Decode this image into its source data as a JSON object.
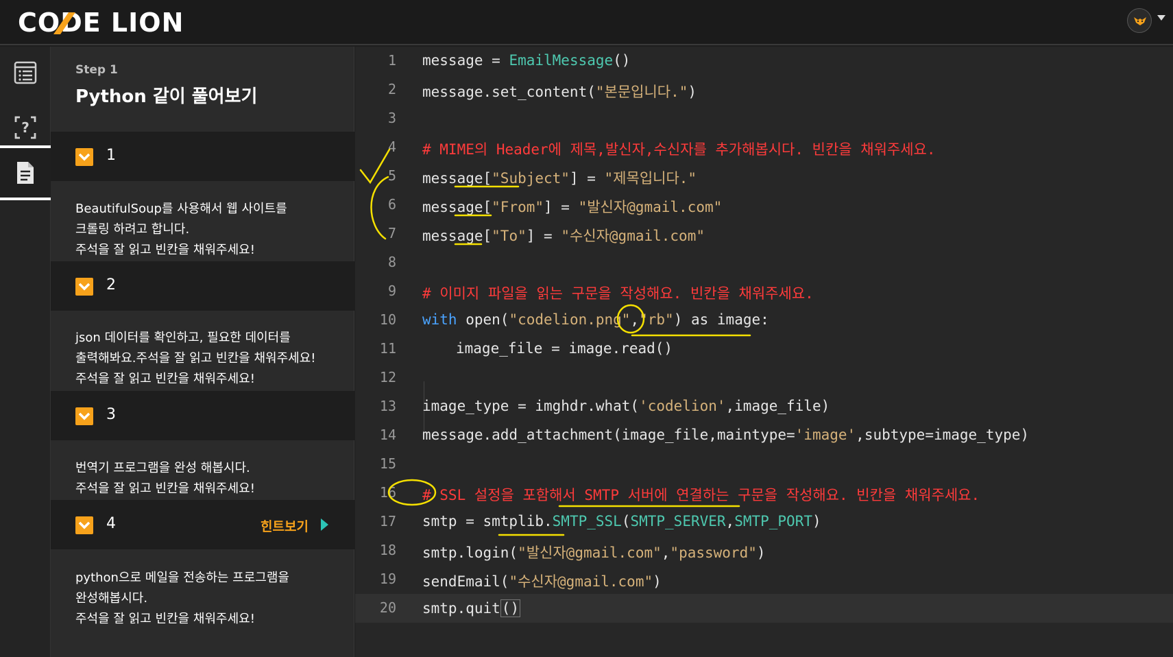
{
  "header": {
    "logo_text": "CODE LION"
  },
  "rail": {
    "items": [
      {
        "name": "list"
      },
      {
        "name": "quiz"
      },
      {
        "name": "document"
      }
    ]
  },
  "panel": {
    "step_label": "Step 1",
    "step_title": "Python 같이 풀어보기",
    "tasks": [
      {
        "num": "1",
        "desc": [
          "BeautifulSoup를 사용해서 웹 사이트를",
          "크롤링 하려고 합니다.",
          "주석을 잘 읽고 빈칸을 채워주세요!"
        ]
      },
      {
        "num": "2",
        "desc": [
          "json 데이터를 확인하고, 필요한 데이터를",
          "출력해봐요.주석을 잘 읽고 빈칸을 채워주세요!",
          "주석을 잘 읽고 빈칸을 채워주세요!"
        ]
      },
      {
        "num": "3",
        "desc": [
          "번역기 프로그램을 완성 해봅시다.",
          "주석을 잘 읽고 빈칸을 채워주세요!"
        ]
      },
      {
        "num": "4",
        "hint": "힌트보기",
        "desc": [
          "python으로 메일을 전송하는 프로그램을",
          "완성해봅시다.",
          "주석을 잘 읽고 빈칸을 채워주세요!"
        ]
      }
    ]
  },
  "editor": {
    "lines": [
      {
        "n": "1"
      },
      {
        "n": "2"
      },
      {
        "n": "3"
      },
      {
        "n": "4"
      },
      {
        "n": "5"
      },
      {
        "n": "6"
      },
      {
        "n": "7"
      },
      {
        "n": "8"
      },
      {
        "n": "9"
      },
      {
        "n": "10"
      },
      {
        "n": "11"
      },
      {
        "n": "12"
      },
      {
        "n": "13"
      },
      {
        "n": "14"
      },
      {
        "n": "15"
      },
      {
        "n": "16"
      },
      {
        "n": "17"
      },
      {
        "n": "18"
      },
      {
        "n": "19"
      },
      {
        "n": "20"
      }
    ],
    "code": {
      "l1_a": "message = ",
      "l1_fn": "EmailMessage",
      "l1_b": "()",
      "l2_a": "message.set_content(",
      "l2_str": "\"본문입니다.\"",
      "l2_b": ")",
      "l4": "# MIME의 Header에 제목,발신자,수신자를 추가해봅시다. 빈칸을 채워주세요.",
      "l5_a": "message[",
      "l5_s1": "\"Subject\"",
      "l5_b": "] = ",
      "l5_s2": "\"제목입니다.\"",
      "l6_a": "message[",
      "l6_s1": "\"From\"",
      "l6_b": "] = ",
      "l6_s2": "\"발신자@gmail.com\"",
      "l7_a": "message[",
      "l7_s1": "\"To\"",
      "l7_b": "] = ",
      "l7_s2": "\"수신자@gmail.com\"",
      "l9": "# 이미지 파일을 읽는 구문을 작성해요. 빈칸을 채워주세요.",
      "l10_kw": "with",
      "l10_a": " open(",
      "l10_s1": "\"codelion.png\"",
      "l10_b": ",",
      "l10_s2": "\"rb\"",
      "l10_c": ") as image:",
      "l11": "image_file = image.read()",
      "l13_a": "image_type = imghdr.what(",
      "l13_s": "'codelion'",
      "l13_b": ",image_file)",
      "l14_a": "message.add_attachment(image_file,maintype=",
      "l14_s": "'image'",
      "l14_b": ",subtype=image_type)",
      "l16": "# SSL 설정을 포함해서 SMTP 서버에 연결하는 구문을 작성해요. 빈칸을 채워주세요.",
      "l17_a": "smtp = smtplib.",
      "l17_fn": "SMTP_SSL",
      "l17_b": "(",
      "l17_fn2": "SMTP_SERVER",
      "l17_c": ",",
      "l17_fn3": "SMTP_PORT",
      "l17_d": ")",
      "l18_a": "smtp.login(",
      "l18_s1": "\"발신자@gmail.com\"",
      "l18_b": ",",
      "l18_s2": "\"password\"",
      "l18_c": ")",
      "l19_a": "sendEmail(",
      "l19_s": "\"수신자@gmail.com\"",
      "l19_b": ")",
      "l20_a": "smtp.quit",
      "l20_b": "()"
    }
  },
  "colors": {
    "accent": "#f7a21b",
    "comment": "#ff3b3b",
    "function": "#4ec9b0",
    "keyword": "#4aa3ff",
    "string": "#d6b27a",
    "annotation": "#f5e000"
  }
}
